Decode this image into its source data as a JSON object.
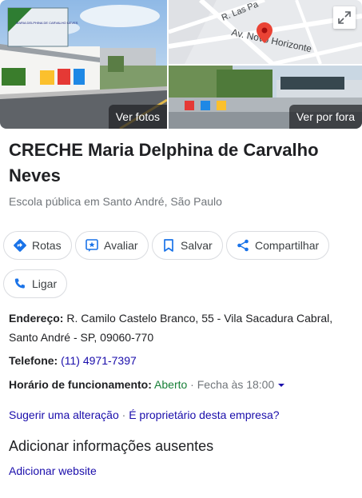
{
  "gallery": {
    "photos_label": "Ver fotos",
    "outside_label": "Ver por fora",
    "map_streets": [
      "R. Las Pa",
      "Av. Novo Horizonte"
    ],
    "sign_text": "MARIA DELPHINA DE CARVALHO NEVES"
  },
  "place": {
    "title": "CRECHE Maria Delphina de Carvalho Neves",
    "category": "Escola pública em Santo André, São Paulo"
  },
  "actions": {
    "routes": "Rotas",
    "review": "Avaliar",
    "save": "Salvar",
    "share": "Compartilhar",
    "call": "Ligar"
  },
  "info": {
    "address_label": "Endereço:",
    "address_line1": "R. Camilo Castelo Branco, 55 - Vila Sacadura Cabral,",
    "address_line2": "Santo André - SP, 09060-770",
    "phone_label": "Telefone:",
    "phone": "(11) 4971-7397",
    "hours_label": "Horário de funcionamento:",
    "hours_status": "Aberto",
    "hours_separator": " · ",
    "hours_close": "Fecha às 18:00",
    "suggest_edit": "Sugerir uma alteração",
    "owner_separator": " · ",
    "owner_question": "É proprietário desta empresa?"
  },
  "missing": {
    "title": "Adicionar informações ausentes",
    "add_website": "Adicionar website"
  },
  "colors": {
    "accent": "#1a73e8",
    "link": "#1a0dab",
    "open": "#188038",
    "pin": "#ea4335"
  }
}
